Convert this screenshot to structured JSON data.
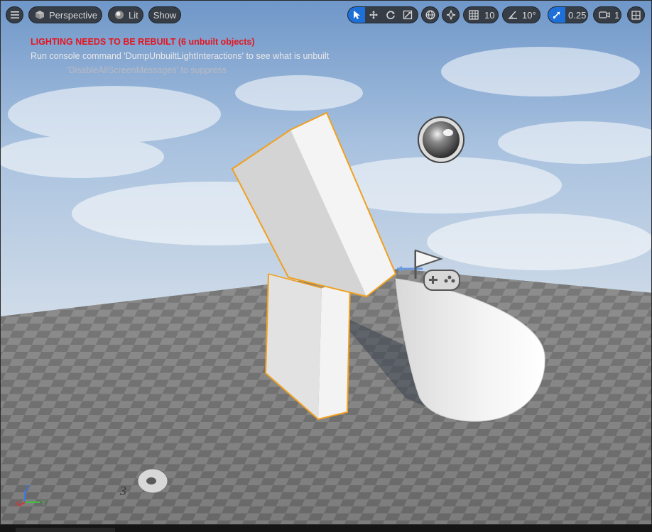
{
  "toolbar": {
    "perspective_label": "Perspective",
    "lit_label": "Lit",
    "show_label": "Show",
    "grid_snap_value": "10",
    "rotation_snap_value": "10°",
    "scale_snap_value": "0.25",
    "camera_speed_value": "1"
  },
  "messages": {
    "lighting_warning": "LIGHTING NEEDS TO BE REBUILT (6 unbuilt objects)",
    "console_hint": "Run console command 'DumpUnbuiltLightInteractions' to see what is unbuilt",
    "suppress_hint": "'DisableAllScreenMessages' to suppress"
  },
  "axis": {
    "x": "X",
    "y": "Y",
    "z": "Z"
  },
  "billboard_number": "3",
  "colors": {
    "accent": "#1f6fd8",
    "warning": "#e4151f",
    "selection": "#f0a020",
    "axis_x": "#e03030",
    "axis_y": "#40c040",
    "axis_z": "#3a7ae8"
  },
  "icons": [
    "hamburger-icon",
    "cube-icon",
    "lit-sphere-icon",
    "select-arrow-icon",
    "move-icon",
    "rotate-icon",
    "scale-icon",
    "globe-icon",
    "surface-snap-icon",
    "grid-icon",
    "angle-icon",
    "scale-snap-icon",
    "camera-icon",
    "maximize-icon"
  ]
}
